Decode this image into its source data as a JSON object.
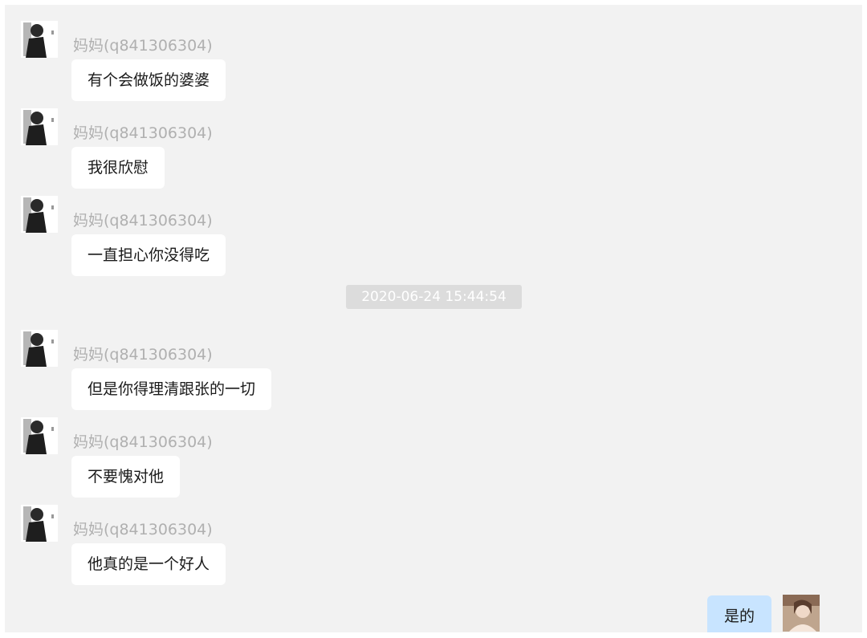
{
  "contact": {
    "name": "妈妈(q841306304)"
  },
  "messages_before": [
    {
      "sender": "妈妈(q841306304)",
      "text": "有个会做饭的婆婆"
    },
    {
      "sender": "妈妈(q841306304)",
      "text": "我很欣慰"
    },
    {
      "sender": "妈妈(q841306304)",
      "text": "一直担心你没得吃"
    }
  ],
  "timestamp": "2020-06-24 15:44:54",
  "messages_after": [
    {
      "sender": "妈妈(q841306304)",
      "text": "但是你得理清跟张的一切"
    },
    {
      "sender": "妈妈(q841306304)",
      "text": "不要愧对他"
    },
    {
      "sender": "妈妈(q841306304)",
      "text": "他真的是一个好人"
    }
  ],
  "self_message": {
    "text": "是的"
  },
  "colors": {
    "chat_background": "#f2f2f2",
    "incoming_bubble": "#ffffff",
    "outgoing_bubble": "#c8e4ff",
    "sender_name": "#b0b0b0",
    "timestamp_bg": "#dcdcdc"
  },
  "icons": {
    "contact_avatar": "avatar-photo-woman-dark",
    "self_avatar": "avatar-photo-woman-light"
  }
}
